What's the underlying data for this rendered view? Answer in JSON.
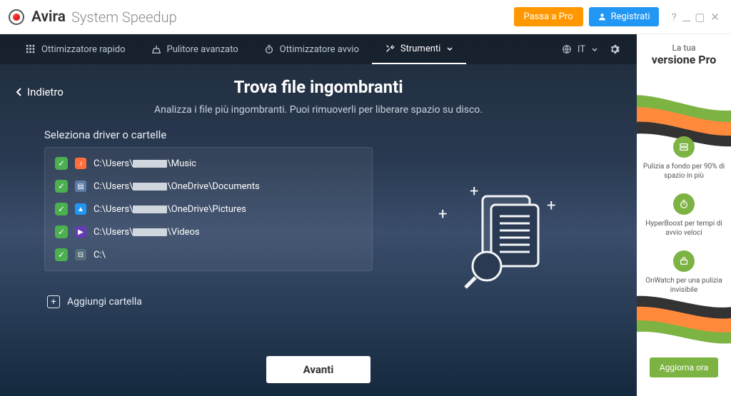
{
  "titlebar": {
    "brand": "Avira",
    "product": "System Speedup",
    "upgrade_button": "Passa a Pro",
    "register_button": "Registrati"
  },
  "nav": {
    "items": [
      {
        "label": "Ottimizzatore rapido",
        "active": false
      },
      {
        "label": "Pulitore avanzato",
        "active": false
      },
      {
        "label": "Ottimizzatore avvio",
        "active": false
      },
      {
        "label": "Strumenti",
        "active": true
      }
    ],
    "language": "IT"
  },
  "back_label": "Indietro",
  "heading": "Trova file ingombranti",
  "subheading": "Analizza i file più ingombranti. Puoi rimuoverli per liberare spazio su disco.",
  "select_label": "Seleziona driver o cartelle",
  "folders": [
    {
      "icon": "music",
      "prefix": "C:\\Users\\",
      "suffix": "\\Music",
      "redacted": true
    },
    {
      "icon": "doc",
      "prefix": "C:\\Users\\",
      "suffix": "\\OneDrive\\Documents",
      "redacted": true
    },
    {
      "icon": "pic",
      "prefix": "C:\\Users\\",
      "suffix": "\\OneDrive\\Pictures",
      "redacted": true
    },
    {
      "icon": "vid",
      "prefix": "C:\\Users\\",
      "suffix": "\\Videos",
      "redacted": true
    },
    {
      "icon": "drv",
      "prefix": "C:\\",
      "suffix": "",
      "redacted": false
    }
  ],
  "add_folder": "Aggiungi cartella",
  "next_button": "Avanti",
  "promo": {
    "line1": "La tua",
    "line2": "versione Pro",
    "items": [
      "Pulizia a fondo per 90% di spazio in più",
      "HyperBoost per tempi di avvio veloci",
      "OnWatch per una pulizia invisibile"
    ],
    "cta": "Aggiorna ora"
  }
}
